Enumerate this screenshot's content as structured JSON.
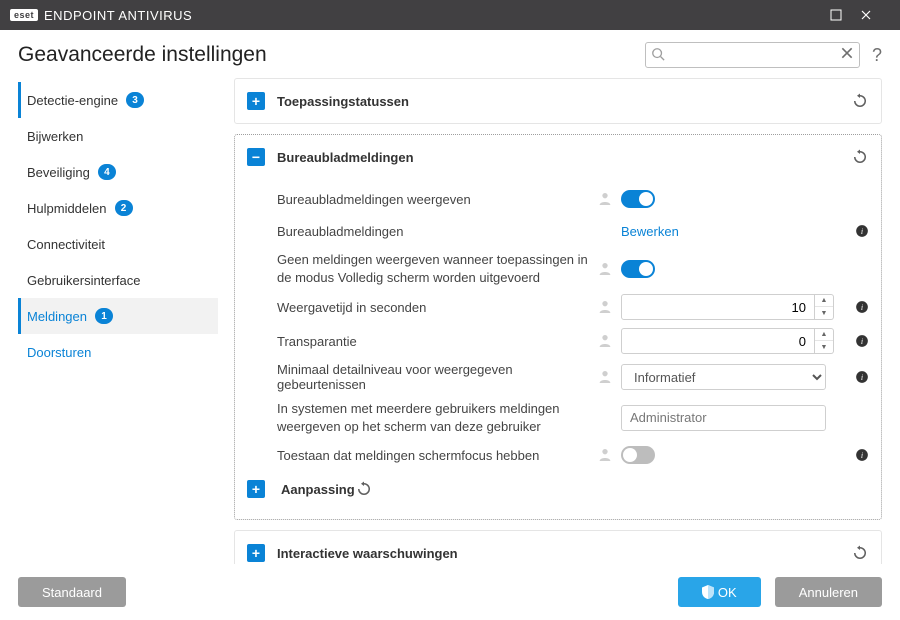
{
  "app": {
    "brand_badge": "eset",
    "brand_text": "ENDPOINT ANTIVIRUS"
  },
  "page": {
    "title": "Geavanceerde instellingen",
    "search_placeholder": ""
  },
  "sidebar": {
    "items": [
      {
        "label": "Detectie-engine",
        "badge": "3"
      },
      {
        "label": "Bijwerken",
        "badge": ""
      },
      {
        "label": "Beveiliging",
        "badge": "4"
      },
      {
        "label": "Hulpmiddelen",
        "badge": "2"
      },
      {
        "label": "Connectiviteit",
        "badge": ""
      },
      {
        "label": "Gebruikersinterface",
        "badge": ""
      },
      {
        "label": "Meldingen",
        "badge": "1"
      }
    ],
    "sub": {
      "label": "Doorsturen"
    }
  },
  "panels": {
    "app_status": {
      "title": "Toepassingstatussen"
    },
    "desktop": {
      "title": "Bureaubladmeldingen",
      "rows": {
        "show": "Bureaubladmeldingen weergeven",
        "edit_label": "Bureaubladmeldingen",
        "edit_action": "Bewerken",
        "fullscreen": "Geen meldingen weergeven wanneer toepassingen in de modus Volledig scherm worden uitgevoerd",
        "duration": "Weergavetijd in seconden",
        "duration_value": "10",
        "transparency": "Transparantie",
        "transparency_value": "0",
        "verbosity": "Minimaal detailniveau voor weergegeven gebeurtenissen",
        "verbosity_value": "Informatief",
        "multiuser": "In systemen met meerdere gebruikers meldingen weergeven op het scherm van deze gebruiker",
        "multiuser_value": "Administrator",
        "focus": "Toestaan dat meldingen schermfocus hebben"
      },
      "sub": {
        "title": "Aanpassing"
      }
    },
    "interactive": {
      "title": "Interactieve waarschuwingen"
    }
  },
  "footer": {
    "default": "Standaard",
    "ok": "OK",
    "cancel": "Annuleren"
  }
}
